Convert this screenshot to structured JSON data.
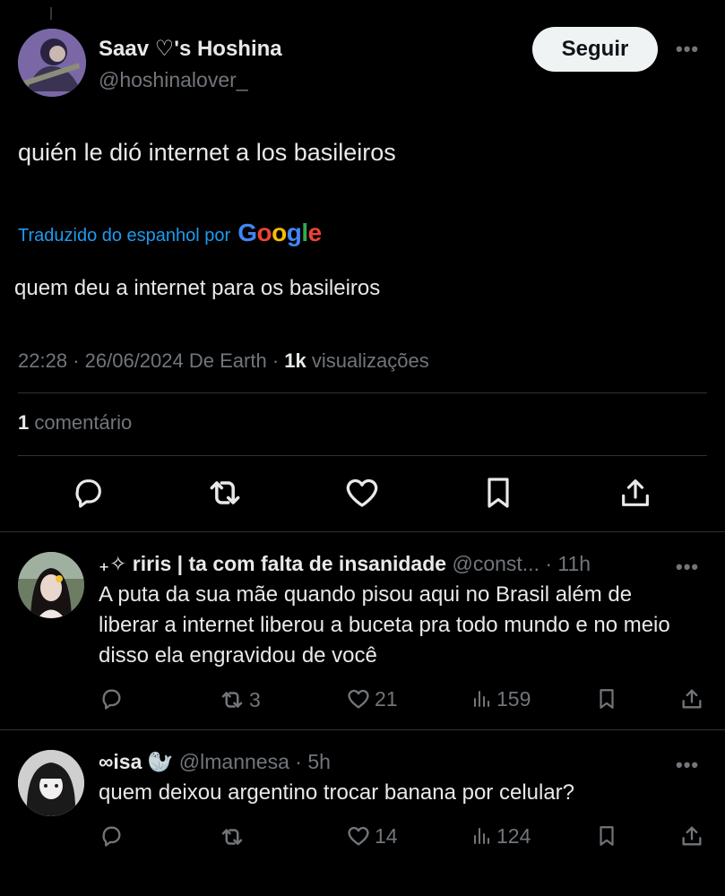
{
  "tweet": {
    "author_name": "Saav ♡'s Hoshina",
    "author_handle": "@hoshinalover_",
    "follow_label": "Seguir",
    "text": "quién le dió internet a los basileiros",
    "translated_by_label": "Traduzido do espanhol por",
    "translation_provider": "Google",
    "translated_text": "quem deu a internet para os basileiros",
    "time": "22:28",
    "date": "26/06/2024",
    "source": "De Earth",
    "views_count": "1k",
    "views_label": "visualizações",
    "comments_count": "1",
    "comments_label": "comentário"
  },
  "google_colors": [
    "#4285F4",
    "#EA4335",
    "#FBBC05",
    "#4285F4",
    "#34A853",
    "#EA4335"
  ],
  "colors": {
    "link": "#1d9bf0",
    "muted": "#71767b",
    "text": "#e7e9ea",
    "divider": "#2f3336"
  },
  "replies": [
    {
      "name": "₊✧ riris | ta com falta de insanidade",
      "handle": "@const...",
      "time": "· 11h",
      "text": "A puta da sua mãe quando pisou aqui no Brasil além de liberar a internet liberou a buceta pra todo mundo e no meio disso ela engravidou de você",
      "retweets": "3",
      "likes": "21",
      "views": "159"
    },
    {
      "name": "∞isa 🦭",
      "handle": "@lmannesa",
      "time": "· 5h",
      "text": "quem deixou argentino trocar banana por celular?",
      "retweets": "",
      "likes": "14",
      "views": "124"
    }
  ],
  "icons": {
    "more": "more-horizontal-icon",
    "reply": "reply-icon",
    "retweet": "retweet-icon",
    "like": "heart-icon",
    "bookmark": "bookmark-icon",
    "share": "share-icon",
    "views": "views-icon"
  }
}
